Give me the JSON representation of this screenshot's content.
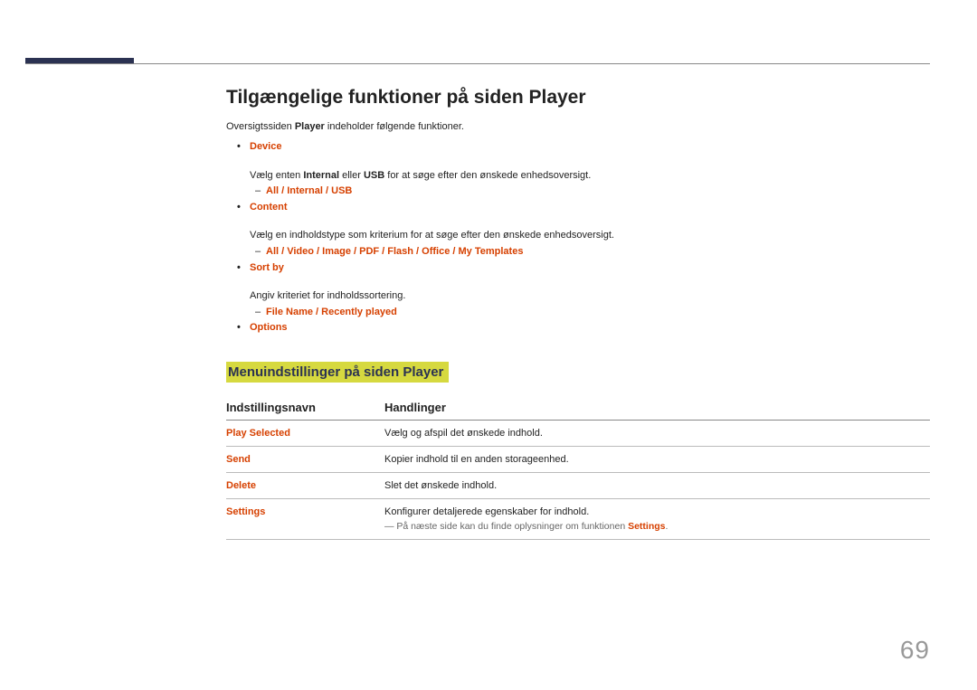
{
  "heading": "Tilgængelige funktioner på siden Player",
  "intro_prefix": "Oversigtssiden ",
  "intro_bold": "Player",
  "intro_suffix": " indeholder følgende funktioner.",
  "items": {
    "device": {
      "label": "Device",
      "desc_pre": "Vælg enten ",
      "desc_b1": "Internal",
      "desc_mid": " eller ",
      "desc_b2": "USB",
      "desc_post": " for at søge efter den ønskede enhedsoversigt.",
      "sub": "All / Internal / USB"
    },
    "content": {
      "label": "Content",
      "desc": "Vælg en indholdstype som kriterium for at søge efter den ønskede enhedsoversigt.",
      "sub": "All / Video / Image / PDF / Flash / Office / My Templates"
    },
    "sortby": {
      "label": "Sort by",
      "desc": "Angiv kriteriet for indholdssortering.",
      "sub": "File Name / Recently played"
    },
    "options": {
      "label": "Options"
    }
  },
  "subheading": "Menuindstillinger på siden Player",
  "table": {
    "h1": "Indstillingsnavn",
    "h2": "Handlinger",
    "rows": [
      {
        "name": "Play Selected",
        "action": "Vælg og afspil det ønskede indhold."
      },
      {
        "name": "Send",
        "action": "Kopier indhold til en anden storageenhed."
      },
      {
        "name": "Delete",
        "action": "Slet det ønskede indhold."
      },
      {
        "name": "Settings",
        "action": "Konfigurer detaljerede egenskaber for indhold."
      }
    ],
    "note_prefix": "― På næste side kan du finde oplysninger om funktionen ",
    "note_bold": "Settings",
    "note_suffix": "."
  },
  "page": "69"
}
